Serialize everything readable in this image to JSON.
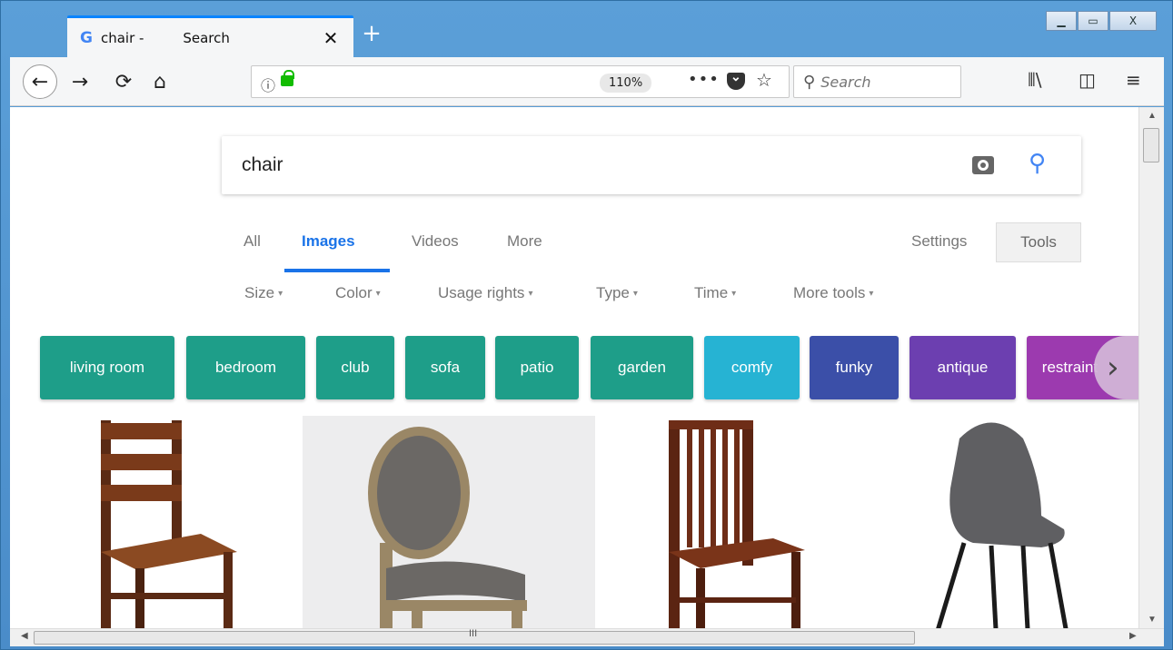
{
  "browser": {
    "tab": {
      "title": "chair -         Search",
      "close_glyph": "✕"
    },
    "new_tab_glyph": "+",
    "window_buttons": {
      "minimize": "▁",
      "maximize": "▭",
      "close": "X"
    },
    "nav": {
      "back": "←",
      "forward": "→",
      "reload": "⟳",
      "home": "⌂"
    },
    "url": {
      "info_glyph": "ⓘ",
      "zoom": "110%",
      "more": "•••",
      "star": "☆"
    },
    "search": {
      "placeholder": "Search",
      "icon": "magnifier-icon"
    },
    "toolbar_right": {
      "library": "⦀\\",
      "sidebar": "◫",
      "menu": "≡"
    }
  },
  "google": {
    "query": "chair",
    "tabs": [
      {
        "label": "All"
      },
      {
        "label": "Images",
        "active": true
      },
      {
        "label": "Videos"
      },
      {
        "label": "More"
      }
    ],
    "settings_label": "Settings",
    "tools_label": "Tools",
    "filters": [
      {
        "label": "Size"
      },
      {
        "label": "Color"
      },
      {
        "label": "Usage rights"
      },
      {
        "label": "Type"
      },
      {
        "label": "Time"
      },
      {
        "label": "More tools"
      }
    ],
    "filter_caret": "▾",
    "chips": [
      {
        "label": "living room",
        "color": "#1e9e89"
      },
      {
        "label": "bedroom",
        "color": "#1e9e89"
      },
      {
        "label": "club",
        "color": "#1e9e89"
      },
      {
        "label": "sofa",
        "color": "#1e9e89"
      },
      {
        "label": "patio",
        "color": "#1e9e89"
      },
      {
        "label": "garden",
        "color": "#1e9e89"
      },
      {
        "label": "comfy",
        "color": "#26b3d3"
      },
      {
        "label": "funky",
        "color": "#3b4fa8"
      },
      {
        "label": "antique",
        "color": "#6c3fb0"
      },
      {
        "label": "restraint",
        "color": "#9c3aaf"
      }
    ],
    "chip_next_glyph": "›",
    "images": [
      {
        "name": "wooden-ladderback-chair-image"
      },
      {
        "name": "upholstered-oval-back-chair-image"
      },
      {
        "name": "wooden-spindle-back-chair-image"
      },
      {
        "name": "gray-fabric-modern-chair-image"
      }
    ]
  },
  "scrollbar": {
    "up": "▲",
    "down": "▼",
    "left": "◀",
    "right": "▶",
    "grip": "III"
  },
  "colors": {
    "accent": "#1a73e8",
    "tab_accent": "#0a84ff",
    "lock": "#12bc00"
  }
}
